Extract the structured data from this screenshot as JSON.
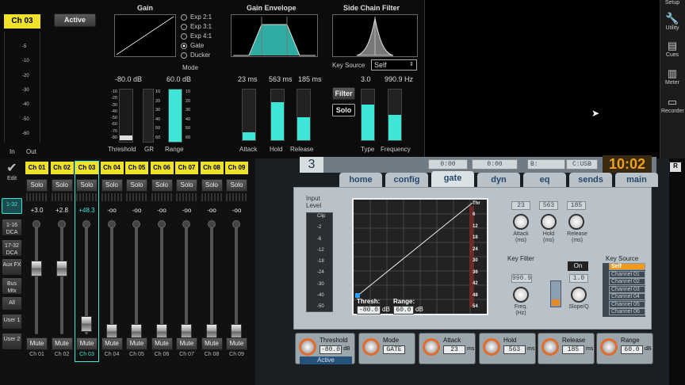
{
  "top": {
    "channel_badge": "Ch 03",
    "active_button": "Active",
    "meter_in": "In",
    "meter_out": "Out",
    "meter_scale": [
      "-5",
      "-10",
      "-20",
      "-30",
      "-40",
      "-50",
      "-60"
    ],
    "gain": {
      "title": "Gain",
      "modes": [
        "Exp 2:1",
        "Exp 3:1",
        "Exp 4:1",
        "Gate",
        "Ducker"
      ],
      "selected_mode_index": 3,
      "mode_label": "Mode",
      "threshold_value": "-80.0 dB",
      "range_value": "60.0 dB",
      "threshold_label": "Threshold",
      "gr_label": "GR",
      "range_label": "Range",
      "threshold_scale": [
        "-10",
        "-20",
        "-30",
        "-40",
        "-50",
        "-60",
        "-70",
        "-80"
      ],
      "gr_scale": [
        "10",
        "20",
        "30",
        "40",
        "50",
        "60"
      ],
      "range_scale": [
        "10",
        "20",
        "30",
        "40",
        "50",
        "60"
      ],
      "range_fill": 1.0
    },
    "envelope": {
      "title": "Gain Envelope",
      "attack_value": "23 ms",
      "hold_value": "563 ms",
      "release_value": "185 ms",
      "attack_label": "Attack",
      "hold_label": "Hold",
      "release_label": "Release",
      "attack_fill": 0.15,
      "hold_fill": 0.75,
      "release_fill": 0.45
    },
    "sidechain": {
      "title": "Side Chain Filter",
      "key_source_label": "Key Source",
      "key_source_value": "Self",
      "filter_button": "Filter",
      "solo_button": "Solo",
      "type_value": "3.0",
      "frequency_value": "990.9 Hz",
      "type_label": "Type",
      "frequency_label": "Frequency",
      "type_fill": 0.7,
      "frequency_fill": 0.5
    },
    "right_toolbar": [
      "Setup",
      "Utility",
      "Cues",
      "Meter",
      "Recorder"
    ]
  },
  "mixer": {
    "edit_label": "Edit",
    "side_buttons": [
      "1-32",
      "1-16 DCA",
      "17-32 DCA",
      "Aux FX",
      "Bus Mtx",
      "All",
      "User 1",
      "User 2"
    ],
    "selected_side_index": 0,
    "channels": [
      {
        "name": "Ch 01",
        "gain": "+3.0",
        "fader": 0.62,
        "bottom": "Ch 01",
        "selected": false
      },
      {
        "name": "Ch 02",
        "gain": "+2.8",
        "fader": 0.62,
        "bottom": "Ch 02",
        "selected": false
      },
      {
        "name": "Ch 03",
        "gain": "+48.3",
        "fader": 0.12,
        "bottom": "Ch 03",
        "selected": true
      },
      {
        "name": "Ch 04",
        "gain": "-oo",
        "fader": 0.05,
        "bottom": "Ch 04",
        "selected": false
      },
      {
        "name": "Ch 05",
        "gain": "-oo",
        "fader": 0.05,
        "bottom": "Ch 05",
        "selected": false
      },
      {
        "name": "Ch 06",
        "gain": "-oo",
        "fader": 0.05,
        "bottom": "Ch 06",
        "selected": false
      },
      {
        "name": "Ch 07",
        "gain": "-oo",
        "fader": 0.05,
        "bottom": "Ch 07",
        "selected": false
      },
      {
        "name": "Ch 08",
        "gain": "-oo",
        "fader": 0.05,
        "bottom": "Ch 08",
        "selected": false
      },
      {
        "name": "Ch 09",
        "gain": "-oo",
        "fader": 0.05,
        "bottom": "Ch 09",
        "selected": false
      }
    ],
    "solo_label": "Solo",
    "mute_label": "Mute"
  },
  "photo": {
    "channel_num": "3",
    "time_a": "0:00",
    "time_b": "0:00",
    "usb_b": "B:",
    "usb_label": "C:USB",
    "clock": "10:02",
    "tabs": [
      "home",
      "config",
      "gate",
      "dyn",
      "eq",
      "sends",
      "main"
    ],
    "active_tab_index": 2,
    "input_level_title": "Input Level",
    "input_scale": [
      "Clip",
      "-2",
      "-6",
      "-12",
      "-18",
      "-24",
      "-30",
      "-40",
      "-50"
    ],
    "thr_scale": [
      "Thr",
      "6",
      "12",
      "18",
      "24",
      "30",
      "36",
      "42",
      "48",
      "54"
    ],
    "thresh_label": "Thresh:",
    "thresh_value": "-80.0",
    "range_label": "Range:",
    "range_value": "60.0",
    "db": "dB",
    "attack_lcd": "23",
    "hold_lcd": "563",
    "release_lcd": "185",
    "attack_label": "Attack (ms)",
    "hold_label": "Hold (ms)",
    "release_label": "Release (ms)",
    "key_filter_label": "Key Filter",
    "on_label": "On",
    "freq_lcd": "990.9",
    "slope_lcd": "1.0",
    "freq_label": "Freq. (Hz)",
    "slope_label": "Slope/Q",
    "key_source_label": "Key Source",
    "key_sources": [
      "Self",
      "Channel 01",
      "Channel 02",
      "Channel 03",
      "Channel 04",
      "Channel 05",
      "Channel 06"
    ],
    "selected_source_index": 0,
    "bottom_knobs": [
      {
        "label": "Threshold",
        "value": "-80.0",
        "unit": "dB"
      },
      {
        "label": "Mode",
        "value": "GATE",
        "unit": ""
      },
      {
        "label": "Attack",
        "value": "23",
        "unit": "ms"
      },
      {
        "label": "Hold",
        "value": "563",
        "unit": "ms"
      },
      {
        "label": "Release",
        "value": "185",
        "unit": "ms"
      },
      {
        "label": "Range",
        "value": "60.0",
        "unit": "dB"
      }
    ],
    "active_label": "Active",
    "corner_r": "R"
  },
  "colors": {
    "accent": "#3ee6d8",
    "channel_yellow": "#f0e22a",
    "photo_panel": "#b9c2c9"
  }
}
